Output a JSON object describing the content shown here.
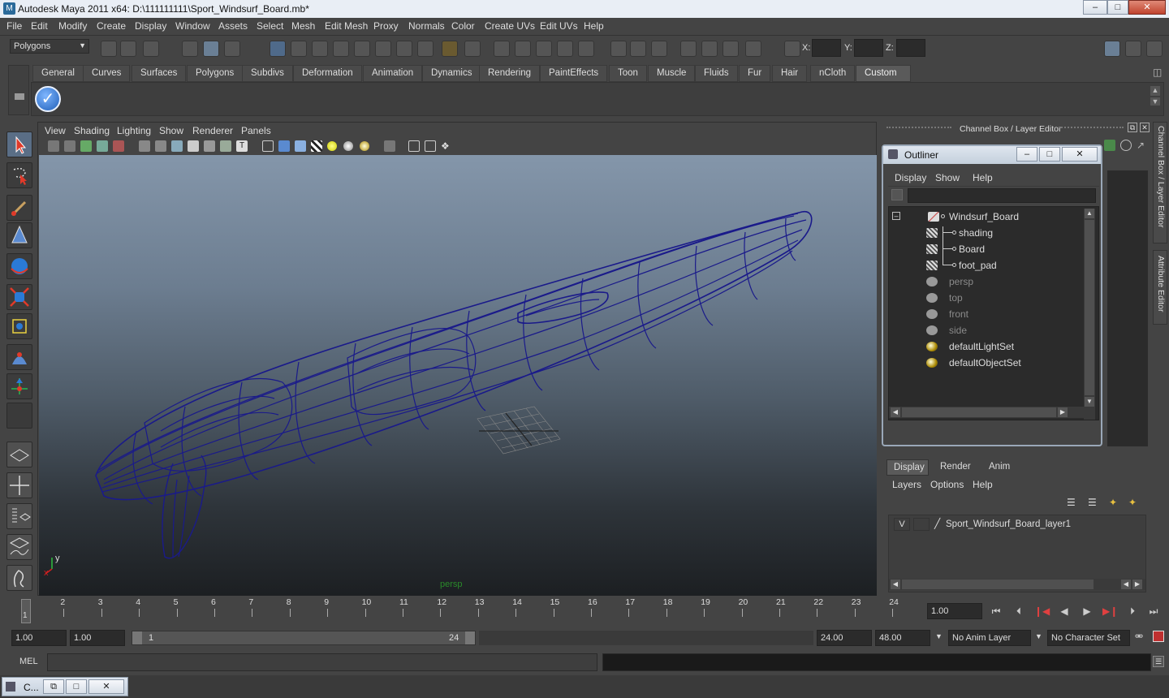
{
  "title_bar": {
    "text": "Autodesk Maya 2011 x64: D:\\111111111\\Sport_Windsurf_Board.mb*"
  },
  "menus": [
    "File",
    "Edit",
    "Modify",
    "Create",
    "Display",
    "Window",
    "Assets",
    "Select",
    "Mesh",
    "Edit Mesh",
    "Proxy",
    "Normals",
    "Color",
    "Create UVs",
    "Edit UVs",
    "Help"
  ],
  "toolbar": {
    "mode_select": "Polygons",
    "x_label": "X:",
    "y_label": "Y:",
    "z_label": "Z:"
  },
  "shelf_tabs": [
    "General",
    "Curves",
    "Surfaces",
    "Polygons",
    "Subdivs",
    "Deformation",
    "Animation",
    "Dynamics",
    "Rendering",
    "PaintEffects",
    "Toon",
    "Muscle",
    "Fluids",
    "Fur",
    "Hair",
    "nCloth",
    "Custom"
  ],
  "shelf_active": "Custom",
  "viewport": {
    "menus": [
      "View",
      "Shading",
      "Lighting",
      "Show",
      "Renderer",
      "Panels"
    ],
    "camera_label": "persp",
    "axis_x": "x",
    "axis_y": "y"
  },
  "channel_box": {
    "title": "Channel Box / Layer Editor",
    "side_tab_1": "Channel Box / Layer Editor",
    "side_tab_2": "Attribute Editor"
  },
  "outliner": {
    "title": "Outliner",
    "menus": [
      "Display",
      "Show",
      "Help"
    ],
    "items": [
      {
        "label": "Windsurf_Board",
        "icon": "transform-icon"
      },
      {
        "label": "shading",
        "icon": "mesh-icon"
      },
      {
        "label": "Board",
        "icon": "mesh-icon"
      },
      {
        "label": "foot_pad",
        "icon": "mesh-icon"
      },
      {
        "label": "persp",
        "icon": "camera-icon"
      },
      {
        "label": "top",
        "icon": "camera-icon"
      },
      {
        "label": "front",
        "icon": "camera-icon"
      },
      {
        "label": "side",
        "icon": "camera-icon"
      },
      {
        "label": "defaultLightSet",
        "icon": "set-icon"
      },
      {
        "label": "defaultObjectSet",
        "icon": "set-icon"
      }
    ]
  },
  "layer_editor": {
    "tabs": [
      "Display",
      "Render",
      "Anim"
    ],
    "menus": [
      "Layers",
      "Options",
      "Help"
    ],
    "layer": {
      "visibility": "V",
      "name": "Sport_Windsurf_Board_layer1"
    }
  },
  "timeline": {
    "ticks": [
      "1",
      "2",
      "3",
      "4",
      "5",
      "6",
      "7",
      "8",
      "9",
      "10",
      "11",
      "12",
      "13",
      "14",
      "15",
      "16",
      "17",
      "18",
      "19",
      "20",
      "21",
      "22",
      "23",
      "24"
    ],
    "current_frame_marker": "1",
    "current_time": "1.00"
  },
  "range": {
    "start": "1.00",
    "playback_start": "1.00",
    "slider_start": "1",
    "slider_end": "24",
    "playback_end": "24.00",
    "end": "48.00",
    "anim_layer": "No Anim Layer",
    "character_set": "No Character Set"
  },
  "mel": {
    "label": "MEL"
  },
  "taskbar": {
    "label": "C..."
  }
}
